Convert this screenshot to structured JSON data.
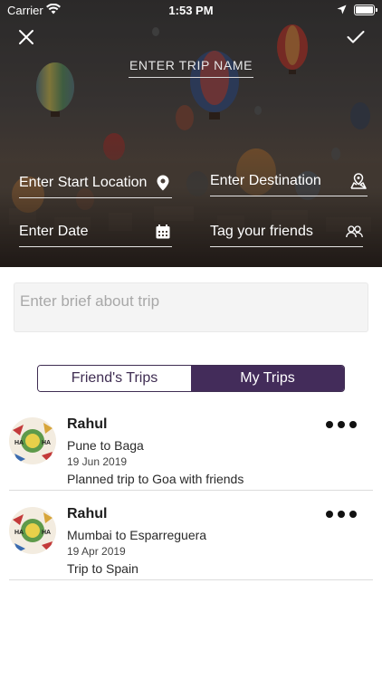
{
  "status_bar": {
    "carrier": "Carrier",
    "time": "1:53 PM"
  },
  "header": {
    "trip_name_placeholder": "ENTER TRIP NAME",
    "close_icon": "close-icon",
    "confirm_icon": "checkmark-icon"
  },
  "form": {
    "start_location": "Enter Start Location",
    "destination": "Enter Destination",
    "date": "Enter Date",
    "tag_friends": "Tag your friends",
    "brief_placeholder": "Enter brief about trip"
  },
  "tabs": [
    {
      "label": "Friend's Trips",
      "active": false
    },
    {
      "label": "My Trips",
      "active": true
    }
  ],
  "trips": [
    {
      "user": "Rahul",
      "route": "Pune to Baga",
      "date": "19 Jun 2019",
      "description": "Planned trip to Goa with friends"
    },
    {
      "user": "Rahul",
      "route": "Mumbai to Esparreguera",
      "date": "19 Apr 2019",
      "description": "Trip to Spain"
    }
  ],
  "colors": {
    "accent": "#432c5a",
    "field_line": "#e5e5e5",
    "brief_bg": "#f4f4f4"
  }
}
